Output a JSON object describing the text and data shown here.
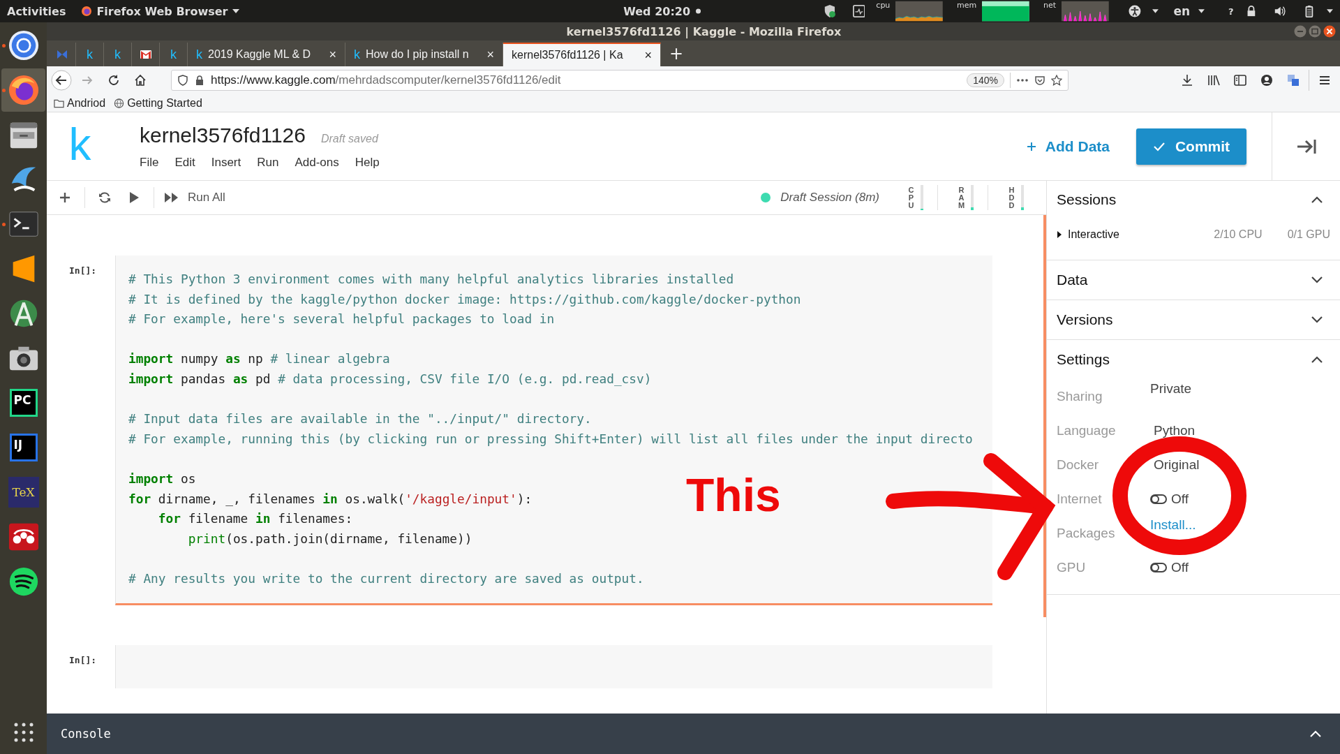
{
  "topbar": {
    "activities": "Activities",
    "app_menu": "Firefox Web Browser",
    "clock": "Wed 20:20",
    "graphs": [
      {
        "label": "cpu",
        "kind": "cpu"
      },
      {
        "label": "mem",
        "kind": "mem"
      },
      {
        "label": "net",
        "kind": "net"
      }
    ],
    "language": "en",
    "help": "?"
  },
  "dock": [
    {
      "kind": "chrome",
      "running": true,
      "selected": false
    },
    {
      "kind": "firefox",
      "running": true,
      "selected": true
    },
    {
      "kind": "files",
      "running": false,
      "selected": false
    },
    {
      "kind": "wave",
      "running": false,
      "selected": false
    },
    {
      "kind": "terminal",
      "running": true,
      "selected": false
    },
    {
      "kind": "sublime",
      "running": false,
      "selected": false
    },
    {
      "kind": "android",
      "running": false,
      "selected": false
    },
    {
      "kind": "camera",
      "running": false,
      "selected": false
    },
    {
      "kind": "ide",
      "label": "PC",
      "running": false,
      "selected": false
    },
    {
      "kind": "ide",
      "label": "IJ",
      "running": false,
      "selected": false
    },
    {
      "kind": "tex",
      "label": "TeX",
      "running": false,
      "selected": false
    },
    {
      "kind": "mendeley",
      "running": false,
      "selected": false
    },
    {
      "kind": "spotify",
      "running": false,
      "selected": false
    }
  ],
  "window": {
    "title": "kernel3576fd1126 | Kaggle - Mozilla Firefox"
  },
  "tabs": [
    {
      "kind": "bowtie",
      "selected": false
    },
    {
      "kind": "site",
      "favicon": "k",
      "selected": false
    },
    {
      "kind": "site",
      "favicon": "k",
      "selected": false
    },
    {
      "kind": "mail",
      "selected": false
    },
    {
      "kind": "site",
      "favicon": "k",
      "selected": false
    },
    {
      "kind": "site",
      "favicon": "k",
      "title": "2019 Kaggle ML & D",
      "close": "×",
      "selected": false
    },
    {
      "kind": "site",
      "favicon": "k",
      "title": "How do I pip install n",
      "close": "×",
      "selected": false
    },
    {
      "kind": "plain",
      "title": "kernel3576fd1126 | Ka",
      "close": "×",
      "selected": true
    }
  ],
  "new_tab": "+",
  "url_bar": {
    "url_host": "https://www.kaggle.com",
    "url_path": "/mehrdadscomputer/kernel3576fd1126/edit",
    "zoom": "140%"
  },
  "bookmarks": [
    {
      "kind": "folder",
      "label": "Andriod"
    },
    {
      "kind": "globe",
      "label": "Getting Started"
    }
  ],
  "kaggle": {
    "logo": "k",
    "title": "kernel3576fd1126",
    "status": "Draft saved",
    "menu": [
      "File",
      "Edit",
      "Insert",
      "Run",
      "Add-ons",
      "Help"
    ],
    "add_data": "Add Data",
    "commit": "Commit"
  },
  "toolbar": {
    "run_all": "Run All",
    "session": "Draft Session (8m)",
    "session_active": true,
    "meters": [
      {
        "label": "CPU",
        "level": 0.05
      },
      {
        "label": "RAM",
        "level": 0.1
      },
      {
        "label": "HDD",
        "level": 0.12
      }
    ]
  },
  "cells": [
    {
      "prompt": "In[]:",
      "selected": true,
      "lines": [
        {
          "tokens": [
            {
              "kind": "comment",
              "text": "# This Python 3 environment comes with many helpful analytics libraries installed"
            }
          ]
        },
        {
          "tokens": [
            {
              "kind": "comment",
              "text": "# It is defined by the kaggle/python docker image: https://github.com/kaggle/docker-python"
            }
          ]
        },
        {
          "tokens": [
            {
              "kind": "comment",
              "text": "# For example, here's several helpful packages to load in"
            }
          ],
          "gap_after": true
        },
        {
          "tokens": [
            {
              "kind": "keyword",
              "text": "import"
            },
            {
              "kind": "plain",
              "text": " numpy "
            },
            {
              "kind": "keyword",
              "text": "as"
            },
            {
              "kind": "plain",
              "text": " np "
            },
            {
              "kind": "comment",
              "text": "# linear algebra"
            }
          ]
        },
        {
          "tokens": [
            {
              "kind": "keyword",
              "text": "import"
            },
            {
              "kind": "plain",
              "text": " pandas "
            },
            {
              "kind": "keyword",
              "text": "as"
            },
            {
              "kind": "plain",
              "text": " pd "
            },
            {
              "kind": "comment",
              "text": "# data processing, CSV file I/O (e.g. pd.read_csv)"
            }
          ],
          "gap_after": true
        },
        {
          "tokens": [
            {
              "kind": "comment",
              "text": "# Input data files are available in the \"../input/\" directory."
            }
          ]
        },
        {
          "tokens": [
            {
              "kind": "comment",
              "text": "# For example, running this (by clicking run or pressing Shift+Enter) will list all files under the input directo"
            }
          ],
          "gap_after": true
        },
        {
          "tokens": [
            {
              "kind": "keyword",
              "text": "import"
            },
            {
              "kind": "plain",
              "text": " os"
            }
          ]
        },
        {
          "tokens": [
            {
              "kind": "keyword",
              "text": "for"
            },
            {
              "kind": "plain",
              "text": " dirname, _, filenames "
            },
            {
              "kind": "keyword",
              "text": "in"
            },
            {
              "kind": "plain",
              "text": " os.walk("
            },
            {
              "kind": "string",
              "text": "'/kaggle/input'"
            },
            {
              "kind": "plain",
              "text": "):"
            }
          ],
          "gap_after": true,
          "children": [
            {
              "tokens": [
                {
                  "kind": "keyword",
                  "text": "for"
                },
                {
                  "kind": "plain",
                  "text": " filename "
                },
                {
                  "kind": "keyword",
                  "text": "in"
                },
                {
                  "kind": "plain",
                  "text": " filenames:"
                }
              ],
              "children": [
                {
                  "tokens": [
                    {
                      "kind": "builtin",
                      "text": "print"
                    },
                    {
                      "kind": "plain",
                      "text": "(os.path.join(dirname, filename))"
                    }
                  ]
                }
              ]
            }
          ]
        },
        {
          "tokens": [
            {
              "kind": "comment",
              "text": "# Any results you write to the current directory are saved as output."
            }
          ]
        }
      ]
    },
    {
      "prompt": "In[]:",
      "selected": false
    }
  ],
  "sidebar": {
    "sections": [
      {
        "title": "Sessions",
        "expanded": true,
        "sessions": [
          {
            "name": "Interactive",
            "expanded": false,
            "cpu": "2/10 CPU",
            "gpu": "0/1 GPU"
          }
        ]
      },
      {
        "title": "Data",
        "expanded": false
      },
      {
        "title": "Versions",
        "expanded": false
      },
      {
        "title": "Settings",
        "expanded": true,
        "settings": [
          {
            "label": "Sharing",
            "kind": "text",
            "value": "Private"
          },
          {
            "label": "Language",
            "kind": "text",
            "value": "Python"
          },
          {
            "label": "Docker",
            "kind": "text",
            "value": "Original"
          },
          {
            "label": "Internet",
            "kind": "toggle",
            "on": false,
            "value": "Off"
          },
          {
            "label": "Packages",
            "kind": "link",
            "value": "Install..."
          },
          {
            "label": "GPU",
            "kind": "toggle",
            "on": false,
            "value": "Off"
          }
        ]
      }
    ]
  },
  "console": {
    "label": "Console"
  },
  "annotation": {
    "label": "This"
  }
}
